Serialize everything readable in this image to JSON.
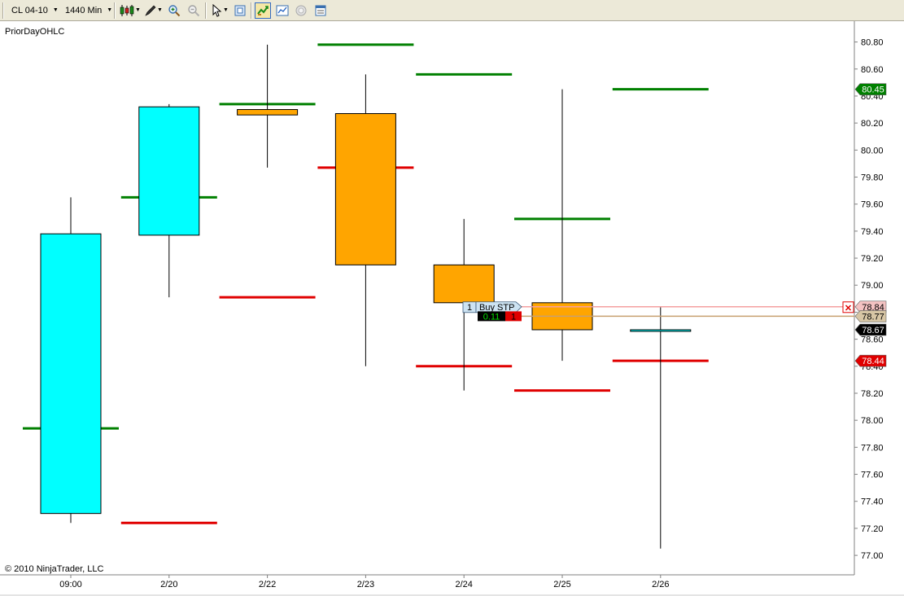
{
  "toolbar": {
    "instrument": "CL 04-10",
    "interval": "1440 Min",
    "icons": [
      "grip-icon",
      "candlestick-icon",
      "drawing-pen-icon",
      "zoom-in-icon",
      "zoom-out-icon",
      "cursor-icon",
      "data-box-icon",
      "instrument-link-icon",
      "chart-style-icon",
      "properties-icon",
      "strategies-icon"
    ]
  },
  "chart": {
    "indicator_label": "PriorDayOHLC",
    "copyright": "© 2010 NinjaTrader, LLC",
    "y_range": [
      76.88,
      80.93
    ],
    "price_ticks": [
      "80.80",
      "80.60",
      "80.40",
      "80.20",
      "80.00",
      "79.80",
      "79.60",
      "79.40",
      "79.20",
      "79.00",
      "78.80",
      "78.60",
      "78.40",
      "78.20",
      "78.00",
      "77.80",
      "77.60",
      "77.40",
      "77.20",
      "77.00"
    ],
    "x_labels": [
      "09:00",
      "2/20",
      "2/22",
      "2/23",
      "2/24",
      "2/25",
      "2/26"
    ],
    "candles": [
      {
        "date": "09:00",
        "open": 77.31,
        "high": 79.65,
        "low": 77.24,
        "close": 79.38,
        "color": "#00ffff"
      },
      {
        "date": "2/20",
        "open": 79.37,
        "high": 80.34,
        "low": 78.91,
        "close": 80.32,
        "color": "#00ffff"
      },
      {
        "date": "2/22",
        "open": 80.3,
        "high": 80.78,
        "low": 79.87,
        "close": 80.26,
        "color": "#ffa500"
      },
      {
        "date": "2/23",
        "open": 80.27,
        "high": 80.56,
        "low": 78.4,
        "close": 79.15,
        "color": "#ffa500"
      },
      {
        "date": "2/24",
        "open": 79.15,
        "high": 79.49,
        "low": 78.22,
        "close": 78.87,
        "color": "#ffa500"
      },
      {
        "date": "2/25",
        "open": 78.87,
        "high": 80.45,
        "low": 78.44,
        "close": 78.67,
        "color": "#ffa500"
      },
      {
        "date": "2/26",
        "open": 78.67,
        "high": 78.84,
        "low": 77.05,
        "close": 78.66,
        "color": "#00ffff"
      }
    ],
    "prior_day_lines": [
      {
        "date": "09:00",
        "high": null,
        "low": null,
        "close": 77.94
      },
      {
        "date": "2/20",
        "high": null,
        "low": 77.24,
        "close": 79.65
      },
      {
        "date": "2/22",
        "high": 80.34,
        "low": 78.91,
        "close": null
      },
      {
        "date": "2/23",
        "high": 80.78,
        "low": 79.87,
        "close": null
      },
      {
        "date": "2/24",
        "high": 80.56,
        "low": 78.4,
        "close": null
      },
      {
        "date": "2/25",
        "high": 79.49,
        "low": 78.22,
        "close": null
      },
      {
        "date": "2/26",
        "high": 80.45,
        "low": 78.44,
        "close": null
      }
    ],
    "colors": {
      "high": "#008000",
      "low": "#e00000",
      "close": "#008000"
    },
    "price_markers": [
      {
        "price": 80.45,
        "label": "80.45",
        "bg": "#008000",
        "fg": "#ffffff"
      },
      {
        "price": 78.84,
        "label": "78.84",
        "bg": "#f4c2c2",
        "fg": "#000000"
      },
      {
        "price": 78.77,
        "label": "78.77",
        "bg": "#d7c6a5",
        "fg": "#000000"
      },
      {
        "price": 78.67,
        "label": "78.67",
        "bg": "#000000",
        "fg": "#ffffff"
      },
      {
        "price": 78.44,
        "label": "78.44",
        "bg": "#e00000",
        "fg": "#ffffff"
      }
    ],
    "order": {
      "quantity": "1",
      "type": "Buy STP",
      "stop_price": 78.84,
      "stop_line_color": "#f4a0a0",
      "position_line_price": 78.77,
      "position_line_color": "#c8a070",
      "pnl": "0.11",
      "position_qty": "1",
      "close_glyph": "✕"
    }
  }
}
